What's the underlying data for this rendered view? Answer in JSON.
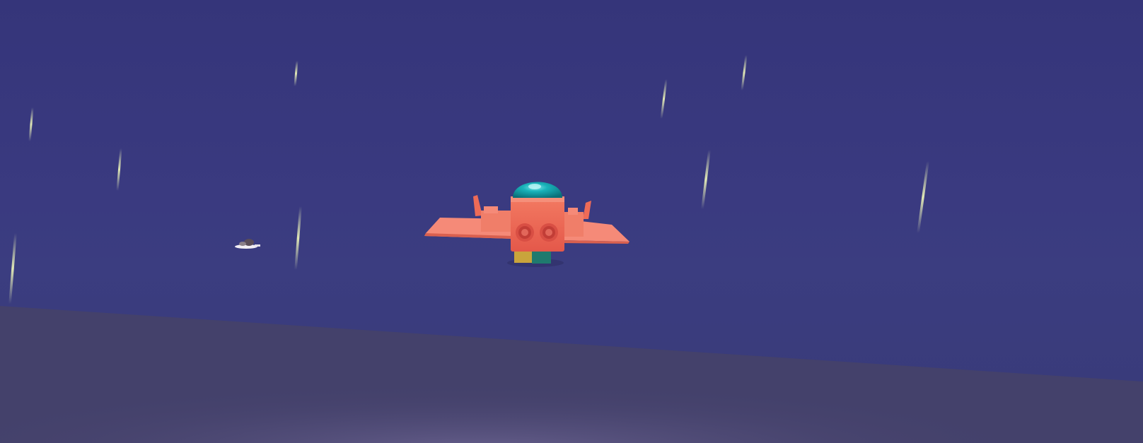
{
  "scene": {
    "type": "3d-flight-game",
    "sky_color": "#363679",
    "ground_color": "#45426b",
    "ground_highlight_color": "#5e5684",
    "rain_color": "#e9f1b8"
  },
  "player_plane": {
    "icon": "toy-airplane",
    "body_color": "#ef6a55",
    "wing_color": "#f58a78",
    "canopy_color": "#0f9ea6",
    "engine_colors": [
      "#c9a43c",
      "#1f7a6e"
    ]
  },
  "distant_plane": {
    "icon": "small-airplane",
    "color": "#e8e4ea"
  }
}
